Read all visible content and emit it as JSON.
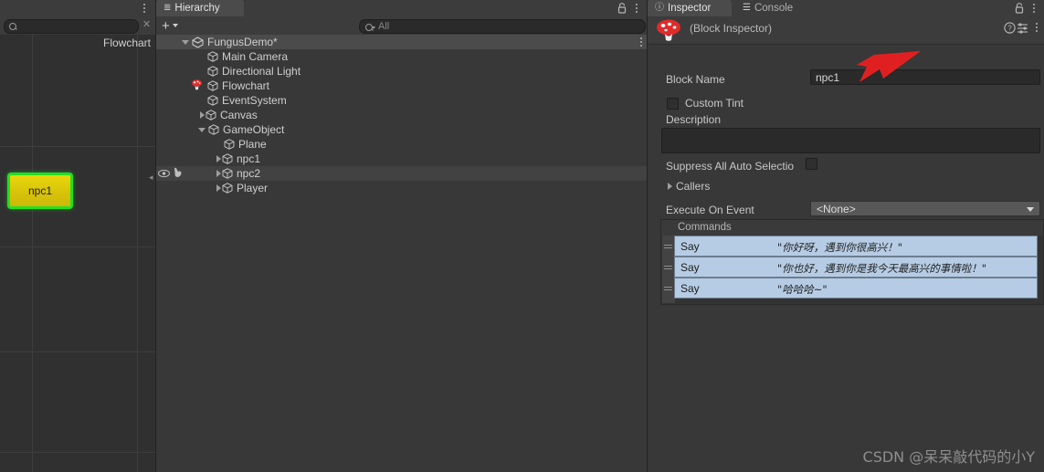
{
  "flowchart": {
    "panel_label": "Flowchart",
    "search_placeholder": "",
    "search_icon": "search-icon",
    "clear_icon": "clear-x-icon",
    "kebab_icon": "kebab-menu-icon",
    "block": {
      "name": "npc1",
      "fill_color": "#ddc80b",
      "selection_color": "#22e022",
      "text_color": "#1b1b1b"
    },
    "grid": {
      "vertical": [
        35,
        150
      ],
      "horizontal": [
        122,
        232,
        347,
        457
      ]
    }
  },
  "hierarchy": {
    "tabs": [
      {
        "label": "Hierarchy",
        "icon": "hierarchy-icon",
        "active": true
      }
    ],
    "lock_icon": "lock-icon",
    "kebab_icon": "kebab-menu-icon",
    "add_label": "+",
    "search_placeholder": "All",
    "search_icon": "search-filter-icon",
    "tree": [
      {
        "label": "FungusDemo*",
        "depth": 0,
        "icon": "scene-icon",
        "twisty": "down",
        "selected": true,
        "kebab": true
      },
      {
        "label": "Main Camera",
        "depth": 1,
        "icon": "gameobject-cube-icon",
        "twisty": "none"
      },
      {
        "label": "Directional Light",
        "depth": 1,
        "icon": "gameobject-cube-icon",
        "twisty": "none"
      },
      {
        "label": "Flowchart",
        "depth": 1,
        "icon": "gameobject-cube-icon",
        "twisty": "none",
        "prefix_icon": "fungus-mushroom-icon"
      },
      {
        "label": "EventSystem",
        "depth": 1,
        "icon": "gameobject-cube-icon",
        "twisty": "none"
      },
      {
        "label": "Canvas",
        "depth": 1,
        "icon": "gameobject-cube-icon",
        "twisty": "right"
      },
      {
        "label": "GameObject",
        "depth": 1,
        "icon": "gameobject-cube-icon",
        "twisty": "down"
      },
      {
        "label": "Plane",
        "depth": 2,
        "icon": "gameobject-cube-icon",
        "twisty": "none"
      },
      {
        "label": "npc1",
        "depth": 2,
        "icon": "gameobject-cube-icon",
        "twisty": "right"
      },
      {
        "label": "npc2",
        "depth": 2,
        "icon": "gameobject-cube-icon",
        "twisty": "right",
        "hovered": true,
        "visibility_icons": [
          "eye-icon",
          "pickability-hand-icon"
        ]
      },
      {
        "label": "Player",
        "depth": 2,
        "icon": "gameobject-cube-icon",
        "twisty": "right"
      }
    ]
  },
  "inspector": {
    "tabs": [
      {
        "label": "Inspector",
        "icon": "info-icon",
        "active": true
      },
      {
        "label": "Console",
        "icon": "console-icon",
        "active": false
      }
    ],
    "lock_icon": "lock-icon",
    "kebab_icon": "kebab-menu-icon",
    "header_title": "(Block Inspector)",
    "header_icon": "fungus-mushroom-icon",
    "help_icon": "help-icon",
    "preset_icon": "preset-icon",
    "header_kebab_icon": "kebab-menu-icon",
    "fields": {
      "block_name_label": "Block Name",
      "block_name_value": "npc1",
      "custom_tint_label": "Custom Tint",
      "custom_tint_checked": false,
      "description_label": "Description",
      "description_value": "",
      "suppress_label": "Suppress All Auto Selectio",
      "suppress_checked": false,
      "callers_label": "Callers",
      "execute_on_event_label": "Execute On Event",
      "execute_on_event_value": "<None>"
    },
    "commands": {
      "header": "Commands",
      "rows": [
        {
          "name": "Say",
          "text": "\"你好呀，遇到你很高兴！\""
        },
        {
          "name": "Say",
          "text": "\"你也好，遇到你是我今天最高兴的事情啦！\""
        },
        {
          "name": "Say",
          "text": "\"哈哈哈~\""
        }
      ],
      "row_bg_color": "#b6cce4"
    }
  },
  "annotation": {
    "arrow_color": "#e02020",
    "arrow_name": "red-pointer-arrow"
  },
  "watermark": {
    "text": "CSDN @呆呆敲代码的小Y"
  }
}
